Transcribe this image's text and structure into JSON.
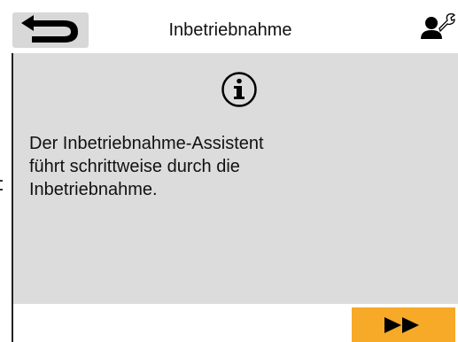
{
  "header": {
    "title": "Inbetriebnahme",
    "back_icon": "back-arrow-icon",
    "user_icon": "service-user-wrench-icon"
  },
  "content": {
    "icon": "info-icon",
    "message": "Der Inbetriebnahme-Assistent\nführt schrittweise durch die\nInbetriebnahme."
  },
  "footer": {
    "next_icon": "fast-forward-icon"
  },
  "colors": {
    "accent": "#f7a928",
    "panel": "#dcdcdc",
    "button": "#d8d8d8"
  }
}
